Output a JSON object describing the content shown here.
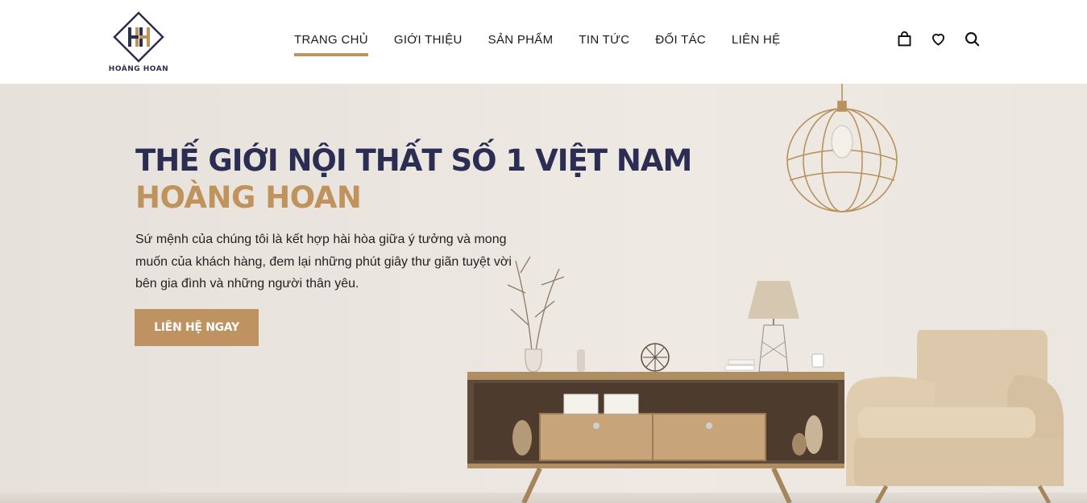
{
  "brand": {
    "name": "HOÀNG HOAN",
    "accent_color": "#bf9361",
    "navy_color": "#2b2d52"
  },
  "nav": {
    "items": [
      {
        "label": "TRANG CHỦ",
        "active": true
      },
      {
        "label": "GIỚI THIỆU",
        "active": false
      },
      {
        "label": "SẢN PHẨM",
        "active": false
      },
      {
        "label": "TIN TỨC",
        "active": false
      },
      {
        "label": "ĐỐI TÁC",
        "active": false
      },
      {
        "label": "LIÊN HỆ",
        "active": false
      }
    ]
  },
  "header_icons": [
    "shopping-bag-icon",
    "heart-icon",
    "search-icon"
  ],
  "hero": {
    "title": "THẾ GIỚI NỘI THẤT SỐ 1 VIỆT NAM",
    "brand_line": "HOÀNG HOAN",
    "description": "Sứ mệnh của chúng tôi là kết hợp hài hòa giữa ý tưởng và mong muốn của khách hàng, đem lại những phút giây thư giãn tuyệt vời bên gia đình và những người thân yêu.",
    "cta_label": "LIÊN HỆ NGAY"
  }
}
